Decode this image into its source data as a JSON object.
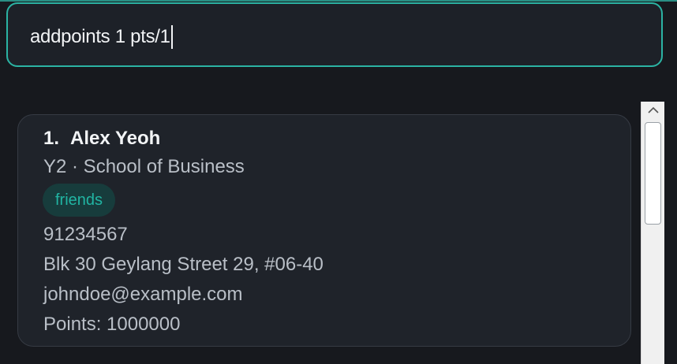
{
  "command": {
    "value": "addpoints 1 pts/1"
  },
  "person": {
    "index": "1.",
    "name": "Alex Yeoh",
    "year_school": "Y2 · School of Business",
    "tags": [
      "friends"
    ],
    "phone": "91234567",
    "address": "Blk 30 Geylang Street 29, #06-40",
    "email": "johndoe@example.com",
    "points": "Points: 1000000"
  },
  "scrollbar": {
    "up_icon": "chevron-up-icon"
  },
  "colors": {
    "accent": "#2bb3a3",
    "background": "#17191e",
    "card": "#1f232a",
    "tag_bg": "#173c3c",
    "tag_text": "#21b5a3"
  }
}
